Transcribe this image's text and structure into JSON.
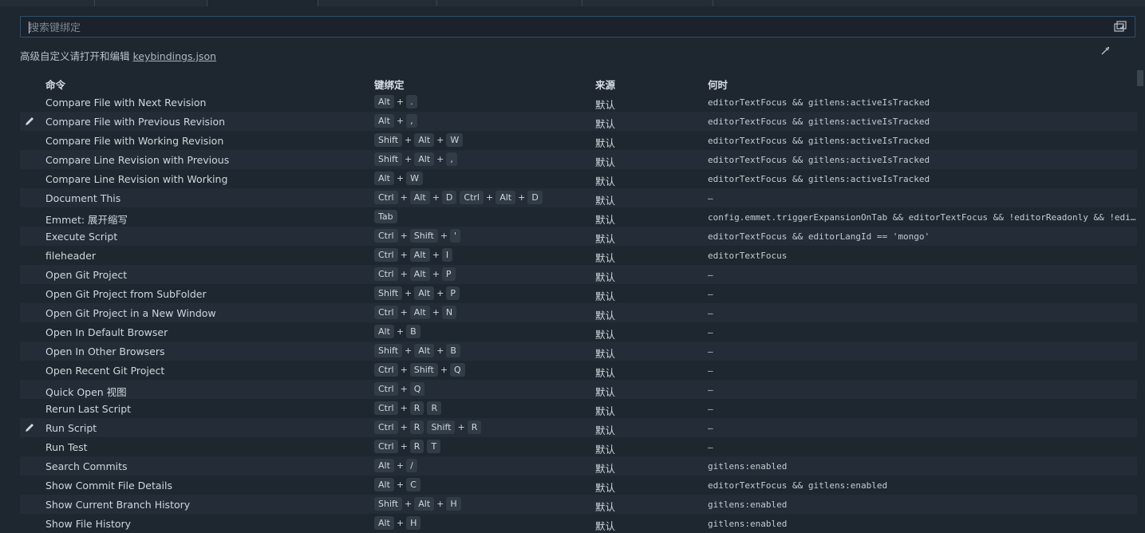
{
  "search": {
    "placeholder": "搜索键绑定",
    "value": ""
  },
  "hint": {
    "text": "高级自定义请打开和编辑",
    "link": "keybindings.json"
  },
  "headers": {
    "command": "命令",
    "keybinding": "键绑定",
    "source": "来源",
    "when": "何时"
  },
  "rows": [
    {
      "command": "Compare File with Next Revision",
      "keys": [
        [
          "Alt",
          "."
        ]
      ],
      "source": "默认",
      "when": "editorTextFocus && gitlens:activeIsTracked",
      "edited": false
    },
    {
      "command": "Compare File with Previous Revision",
      "keys": [
        [
          "Alt",
          ","
        ]
      ],
      "source": "默认",
      "when": "editorTextFocus && gitlens:activeIsTracked",
      "edited": true
    },
    {
      "command": "Compare File with Working Revision",
      "keys": [
        [
          "Shift",
          "Alt",
          "W"
        ]
      ],
      "source": "默认",
      "when": "editorTextFocus && gitlens:activeIsTracked",
      "edited": false
    },
    {
      "command": "Compare Line Revision with Previous",
      "keys": [
        [
          "Shift",
          "Alt",
          ","
        ]
      ],
      "source": "默认",
      "when": "editorTextFocus && gitlens:activeIsTracked",
      "edited": false
    },
    {
      "command": "Compare Line Revision with Working",
      "keys": [
        [
          "Alt",
          "W"
        ]
      ],
      "source": "默认",
      "when": "editorTextFocus && gitlens:activeIsTracked",
      "edited": false
    },
    {
      "command": "Document This",
      "keys": [
        [
          "Ctrl",
          "Alt",
          "D"
        ],
        [
          "Ctrl",
          "Alt",
          "D"
        ]
      ],
      "source": "默认",
      "when": "—",
      "edited": false
    },
    {
      "command": "Emmet: 展开缩写",
      "keys": [
        [
          "Tab"
        ]
      ],
      "source": "默认",
      "when": "config.emmet.triggerExpansionOnTab && editorTextFocus && !editorReadonly && !editorTabMovesFocus",
      "edited": false
    },
    {
      "command": "Execute Script",
      "keys": [
        [
          "Ctrl",
          "Shift",
          "'"
        ]
      ],
      "source": "默认",
      "when": "editorTextFocus && editorLangId == 'mongo'",
      "edited": false
    },
    {
      "command": "fileheader",
      "keys": [
        [
          "Ctrl",
          "Alt",
          "I"
        ]
      ],
      "source": "默认",
      "when": "editorTextFocus",
      "edited": false
    },
    {
      "command": "Open Git Project",
      "keys": [
        [
          "Ctrl",
          "Alt",
          "P"
        ]
      ],
      "source": "默认",
      "when": "—",
      "edited": false
    },
    {
      "command": "Open Git Project from SubFolder",
      "keys": [
        [
          "Shift",
          "Alt",
          "P"
        ]
      ],
      "source": "默认",
      "when": "—",
      "edited": false
    },
    {
      "command": "Open Git Project in a New Window",
      "keys": [
        [
          "Ctrl",
          "Alt",
          "N"
        ]
      ],
      "source": "默认",
      "when": "—",
      "edited": false
    },
    {
      "command": "Open In Default Browser",
      "keys": [
        [
          "Alt",
          "B"
        ]
      ],
      "source": "默认",
      "when": "—",
      "edited": false
    },
    {
      "command": "Open In Other Browsers",
      "keys": [
        [
          "Shift",
          "Alt",
          "B"
        ]
      ],
      "source": "默认",
      "when": "—",
      "edited": false
    },
    {
      "command": "Open Recent Git Project",
      "keys": [
        [
          "Ctrl",
          "Shift",
          "Q"
        ]
      ],
      "source": "默认",
      "when": "—",
      "edited": false
    },
    {
      "command": "Quick Open 视图",
      "keys": [
        [
          "Ctrl",
          "Q"
        ]
      ],
      "source": "默认",
      "when": "—",
      "edited": false
    },
    {
      "command": "Rerun Last Script",
      "keys": [
        [
          "Ctrl",
          "R"
        ],
        [
          "R"
        ]
      ],
      "source": "默认",
      "when": "—",
      "edited": false
    },
    {
      "command": "Run Script",
      "keys": [
        [
          "Ctrl",
          "R"
        ],
        [
          "Shift",
          "R"
        ]
      ],
      "source": "默认",
      "when": "—",
      "edited": true
    },
    {
      "command": "Run Test",
      "keys": [
        [
          "Ctrl",
          "R"
        ],
        [
          "T"
        ]
      ],
      "source": "默认",
      "when": "—",
      "edited": false
    },
    {
      "command": "Search Commits",
      "keys": [
        [
          "Alt",
          "/"
        ]
      ],
      "source": "默认",
      "when": "gitlens:enabled",
      "edited": false
    },
    {
      "command": "Show Commit File Details",
      "keys": [
        [
          "Alt",
          "C"
        ]
      ],
      "source": "默认",
      "when": "editorTextFocus && gitlens:enabled",
      "edited": false
    },
    {
      "command": "Show Current Branch History",
      "keys": [
        [
          "Shift",
          "Alt",
          "H"
        ]
      ],
      "source": "默认",
      "when": "gitlens:enabled",
      "edited": false
    },
    {
      "command": "Show File History",
      "keys": [
        [
          "Alt",
          "H"
        ]
      ],
      "source": "默认",
      "when": "gitlens:enabled",
      "edited": false
    }
  ],
  "colors": {
    "background": "#1e2630",
    "alt_row": "#232c37",
    "key_bg": "#323c47",
    "search_border": "#2f4f6b"
  },
  "icons": {
    "edit": "pencil-icon",
    "record_keys": "record-keys-icon",
    "sort": "sort-icon"
  }
}
